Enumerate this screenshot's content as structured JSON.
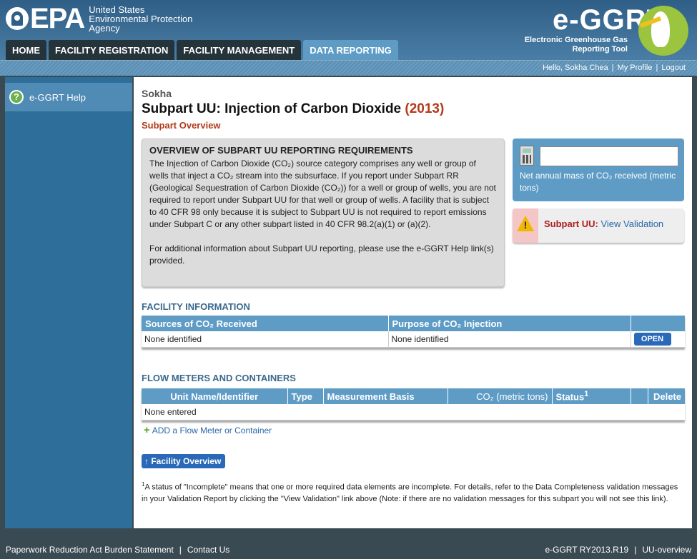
{
  "header": {
    "agency_line1": "United States",
    "agency_line2": "Environmental Protection",
    "agency_line3": "Agency",
    "logo_text": "EPA",
    "app_logo": "e-GGRT",
    "app_sub1": "Electronic Greenhouse Gas",
    "app_sub2": "Reporting Tool"
  },
  "nav": {
    "tabs": [
      {
        "label": "HOME"
      },
      {
        "label": "FACILITY REGISTRATION"
      },
      {
        "label": "FACILITY MANAGEMENT"
      },
      {
        "label": "DATA REPORTING",
        "active": true
      }
    ]
  },
  "userbar": {
    "greeting": "Hello, Sokha Chea",
    "profile": "My Profile",
    "logout": "Logout"
  },
  "sidebar": {
    "help_label": "e-GGRT Help"
  },
  "main": {
    "facility": "Sokha",
    "title": "Subpart UU: Injection of Carbon Dioxide",
    "year": "(2013)",
    "subtitle": "Subpart Overview",
    "overview": {
      "heading": "OVERVIEW OF SUBPART UU REPORTING REQUIREMENTS",
      "p1": "The Injection of Carbon Dioxide (CO₂) source category comprises any well or group of wells that inject a CO₂ stream into the subsurface. If you report under Subpart RR (Geological Sequestration of Carbon Dioxide (CO₂)) for a well or group of wells, you are not required to report under Subpart UU for that well or group of wells. A facility that is subject to 40 CFR 98 only because it is subject to Subpart UU is not required to report emissions under Subpart C or any other subpart listed in 40 CFR 98.2(a)(1) or (a)(2).",
      "p2": "For additional information about Subpart UU reporting, please use the e-GGRT Help link(s) provided."
    },
    "calc": {
      "value": "",
      "label": "Net annual mass of CO₂ received (metric tons)"
    },
    "validation": {
      "label": "Subpart UU:",
      "link": "View Validation"
    },
    "facility_info": {
      "heading": "FACILITY INFORMATION",
      "col1": "Sources of CO₂ Received",
      "col2": "Purpose of CO₂ Injection",
      "row_col1": "None identified",
      "row_col2": "None identified",
      "open_label": "OPEN"
    },
    "flow_meters": {
      "heading": "FLOW METERS AND CONTAINERS",
      "cols": [
        "Unit Name/Identifier",
        "Type",
        "Measurement Basis",
        "CO₂ (metric tons)",
        "Status",
        "Delete"
      ],
      "status_sup": "1",
      "empty": "None entered",
      "add_label": "ADD a Flow Meter or Container"
    },
    "facility_overview_button": "Facility Overview",
    "footnote_sup": "1",
    "footnote": "A status of \"Incomplete\" means that one or more required data elements are incomplete. For details, refer to the Data Completeness validation messages in your Validation Report by clicking the \"View Validation\" link above (Note: if there are no validation messages for this subpart you will not see this link)."
  },
  "footer": {
    "left1": "Paperwork Reduction Act Burden Statement",
    "left2": "Contact Us",
    "right1": "e-GGRT RY2013.R19",
    "right2": "UU-overview"
  },
  "colors": {
    "header_blue": "#2f5e86",
    "accent_blue": "#5e9cc6",
    "title_red": "#b33a1a",
    "link_blue": "#2a68a8",
    "footer_dark": "#3a4a52"
  }
}
